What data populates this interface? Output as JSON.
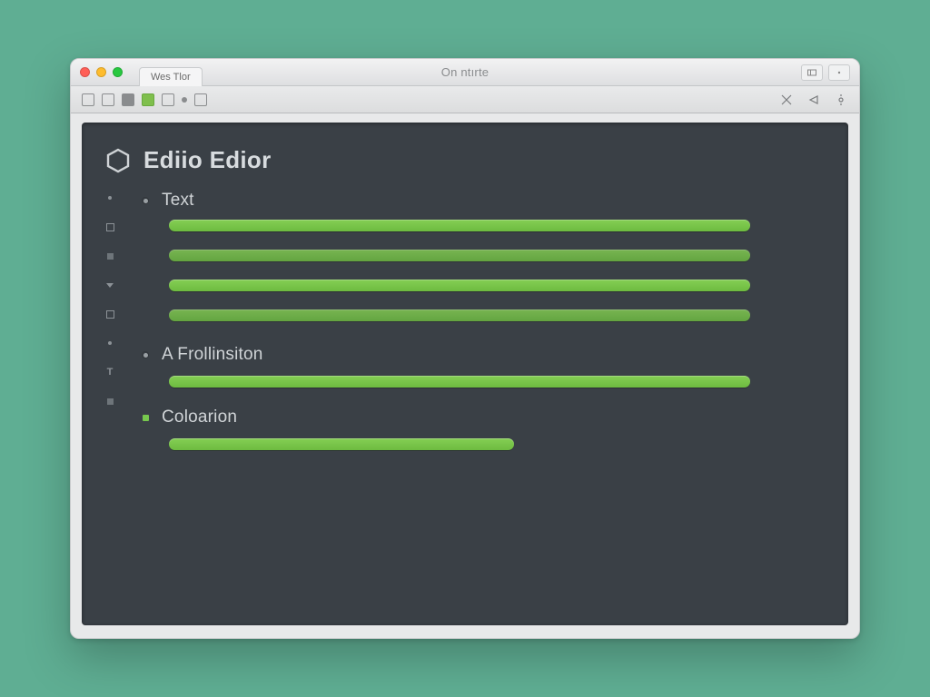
{
  "window": {
    "tab_label": "Wes Tlor",
    "title": "On ntırte"
  },
  "editor": {
    "heading": "Ediio Edior",
    "sections": [
      {
        "label": "Text",
        "bullet": "dot",
        "line_widths": [
          640,
          640,
          640,
          640
        ]
      },
      {
        "label": "A Frollinsiton",
        "bullet": "dot",
        "line_widths": [
          640
        ]
      },
      {
        "label": "Coloarion",
        "bullet": "sq",
        "line_widths": [
          380
        ]
      }
    ]
  },
  "gutter_glyphs": [
    "bullet",
    "box",
    "fillbox",
    "caret",
    "box",
    "bullet",
    "T",
    "fillbox"
  ],
  "colors": {
    "page_bg": "#5fae93",
    "editor_bg": "#3a4046",
    "accent": "#7ac94b"
  }
}
